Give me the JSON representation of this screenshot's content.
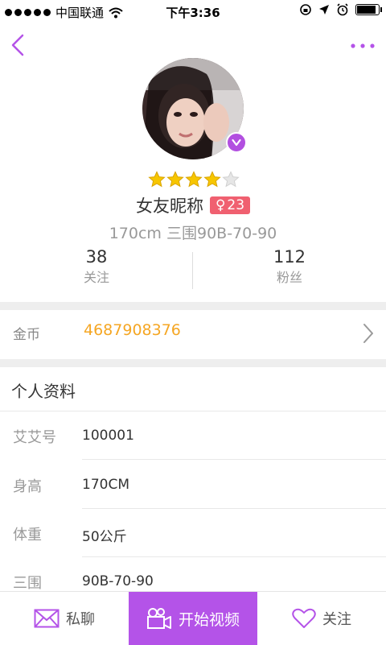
{
  "status_bar": {
    "carrier": "中国联通",
    "time": "下午3:36",
    "battery_level": 0.9
  },
  "profile": {
    "rating": 4,
    "rating_max": 5,
    "nickname": "女友昵称",
    "gender_symbol": "♀",
    "age": "23",
    "measurements": "170cm 三围90B-70-90",
    "following_count": "38",
    "following_label": "关注",
    "fans_count": "112",
    "fans_label": "粉丝"
  },
  "coins": {
    "label": "金币",
    "value": "4687908376"
  },
  "details": {
    "section_title": "个人资料",
    "rows": [
      {
        "label": "艾艾号",
        "value": "100001"
      },
      {
        "label": "身高",
        "value": "170CM"
      },
      {
        "label": "体重",
        "value": "50公斤"
      },
      {
        "label": "三围",
        "value": "90B-70-90"
      }
    ]
  },
  "toolbar": {
    "chat_label": "私聊",
    "video_label": "开始视频",
    "follow_label": "关注"
  },
  "colors": {
    "accent": "#b453e8",
    "coins": "#f5a623",
    "gender_badge": "#f06070",
    "star": "#f7c600"
  },
  "icons": {
    "back": "chevron-left-icon",
    "more": "more-dots-icon",
    "verified": "verified-v-icon",
    "coins_arrow": "chevron-right-icon",
    "chat": "envelope-icon",
    "video": "video-camera-icon",
    "follow": "heart-icon"
  }
}
